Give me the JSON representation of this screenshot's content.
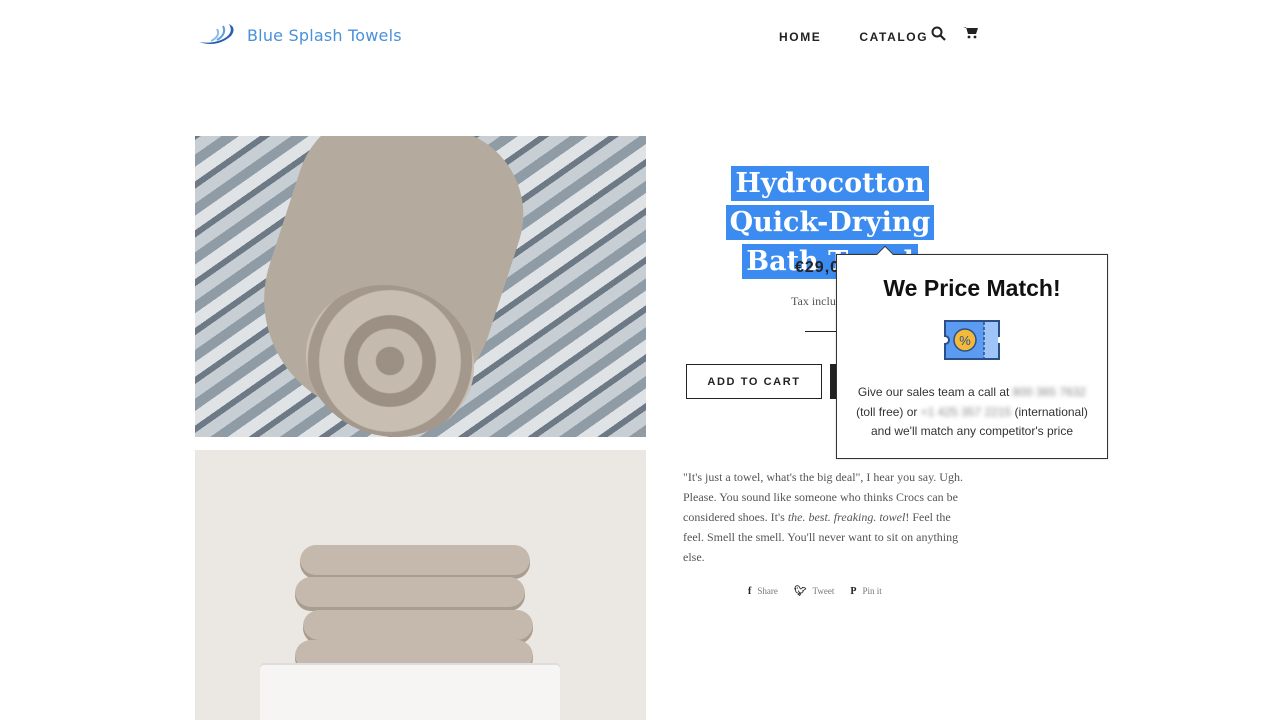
{
  "header": {
    "logo_text": "Blue Splash Towels",
    "nav": [
      "HOME",
      "CATALOG"
    ],
    "icons": [
      "search-icon",
      "cart-icon"
    ]
  },
  "product": {
    "title": "Hydrocotton Quick-Drying Bath Towel",
    "price": "€29,0",
    "tax_note": "Tax inclu",
    "add_to_cart": "ADD TO CART",
    "description": {
      "line1": "\"It's just a towel, what's the big deal\", I hear you say. Ugh. Please. You sound like someone who thinks Crocs can be considered shoes. It's ",
      "emphasis": "the. best. freaking. towel",
      "line2": "! Feel the feel. Smell the smell. You'll never want to sit on anything else."
    },
    "share": [
      "Share",
      "Tweet",
      "Pin it"
    ]
  },
  "popup": {
    "title": "We Price Match!",
    "text_1": "Give our sales team a call at ",
    "phone_1": "800 365 7632",
    "text_2": "(toll free) or ",
    "phone_2": "+1 425 357 2215",
    "text_3": " (international)",
    "text_4": "and we'll match any competitor's price",
    "icon": "discount-coupon-icon",
    "colors": {
      "coupon": "#5b9cf2",
      "badge": "#f5b93a"
    }
  },
  "colors": {
    "selection": "#3b8bf0",
    "logo": "#4a90d9"
  }
}
